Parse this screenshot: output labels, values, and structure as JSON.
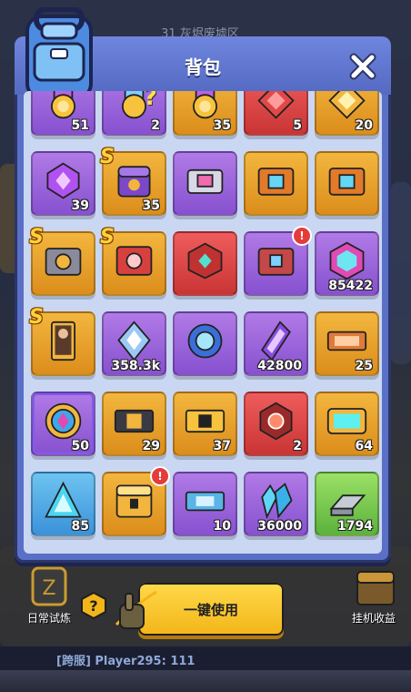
{
  "title": "背包",
  "banner": "31 灰烬废墟区",
  "actions": {
    "use_all": "一键使用",
    "daily_trial": "日常试炼",
    "idle_income": "挂机收益"
  },
  "chat": {
    "line": "[跨服] Player295: 111"
  },
  "colors": {
    "panel": "#5a6fc6",
    "inner": "#cad7f2",
    "button": "#f3b519"
  },
  "items": [
    {
      "rarity": "purple",
      "icon": "medal-ticket-icon",
      "qty": "51"
    },
    {
      "rarity": "purple",
      "icon": "mystery-medal-icon",
      "qty": "2",
      "question": "?"
    },
    {
      "rarity": "gold",
      "icon": "medal-ticket-icon",
      "qty": "35"
    },
    {
      "rarity": "red",
      "icon": "red-emblem-icon",
      "qty": "5"
    },
    {
      "rarity": "gold",
      "icon": "gold-emblem-icon",
      "qty": "20"
    },
    {
      "rarity": "purple",
      "icon": "purple-gem-badge-icon",
      "qty": "39"
    },
    {
      "rarity": "gold",
      "icon": "purple-mystery-chest-icon",
      "qty": "35",
      "s": "S"
    },
    {
      "rarity": "purple",
      "icon": "pink-crate-icon",
      "qty": ""
    },
    {
      "rarity": "gold",
      "icon": "orange-crate-icon",
      "qty": ""
    },
    {
      "rarity": "gold",
      "icon": "orange-crate-icon",
      "qty": ""
    },
    {
      "rarity": "gold",
      "icon": "gear-crate-icon",
      "qty": "",
      "s": "S"
    },
    {
      "rarity": "gold",
      "icon": "red-speaker-crate-icon",
      "qty": "",
      "s": "S"
    },
    {
      "rarity": "red",
      "icon": "red-cube-icon",
      "qty": ""
    },
    {
      "rarity": "purple",
      "icon": "red-chest-icon",
      "qty": "",
      "alert": "!"
    },
    {
      "rarity": "purple",
      "icon": "hex-crystal-icon",
      "qty": "85422"
    },
    {
      "rarity": "gold",
      "icon": "hero-card-icon",
      "qty": "",
      "s": "S"
    },
    {
      "rarity": "purple",
      "icon": "crystal-shard-icon",
      "qty": "358.3k"
    },
    {
      "rarity": "purple",
      "icon": "blue-ring-icon",
      "qty": ""
    },
    {
      "rarity": "purple",
      "icon": "purple-prism-icon",
      "qty": "42800"
    },
    {
      "rarity": "gold",
      "icon": "ticket-icon",
      "qty": "25"
    },
    {
      "rarity": "purple",
      "icon": "rainbow-emblem-icon",
      "qty": "50",
      "frame": true
    },
    {
      "rarity": "gold",
      "icon": "ticket-card-icon",
      "qty": "29"
    },
    {
      "rarity": "gold",
      "icon": "gold-ticket-icon",
      "qty": "37"
    },
    {
      "rarity": "red",
      "icon": "red-core-icon",
      "qty": "2"
    },
    {
      "rarity": "gold",
      "icon": "cyan-card-icon",
      "qty": "64"
    },
    {
      "rarity": "blue",
      "icon": "cyan-prism-icon",
      "qty": "85"
    },
    {
      "rarity": "gold",
      "icon": "gold-chest-icon",
      "qty": "",
      "alert": "!"
    },
    {
      "rarity": "purple",
      "icon": "blue-ticket-icon",
      "qty": "10"
    },
    {
      "rarity": "purple",
      "icon": "blue-crystal-cluster-icon",
      "qty": "36000"
    },
    {
      "rarity": "green",
      "icon": "steel-ingot-icon",
      "qty": "1794"
    }
  ]
}
